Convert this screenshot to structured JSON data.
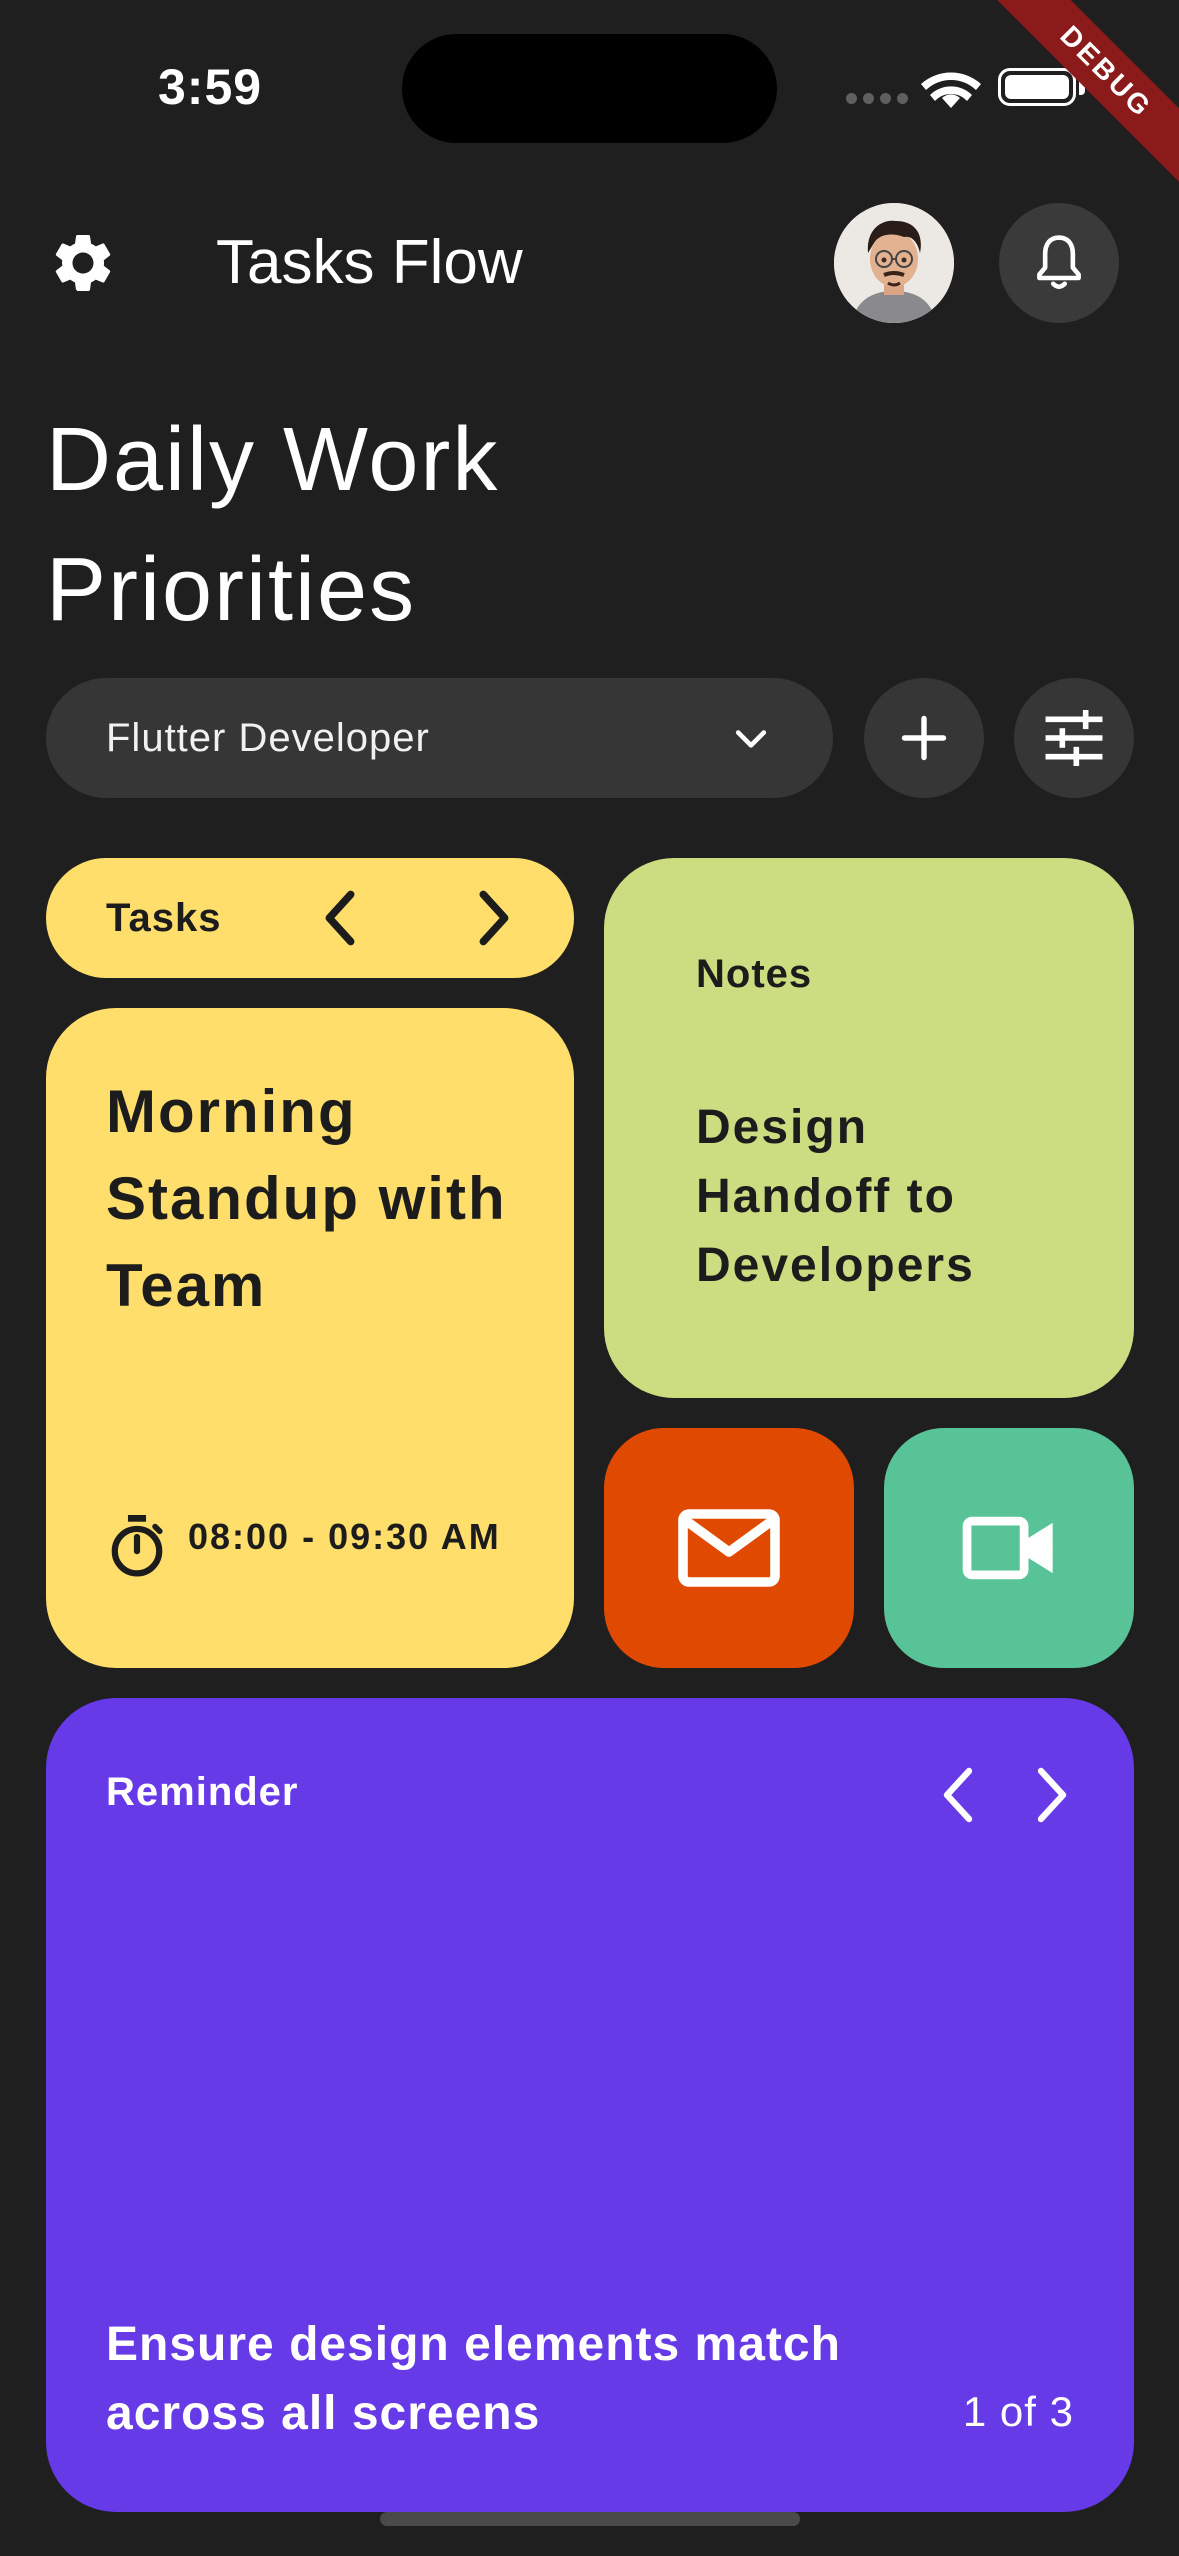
{
  "status_bar": {
    "time": "3:59",
    "debug_banner": "DEBUG"
  },
  "app_bar": {
    "title": "Tasks Flow",
    "settings_icon": "gear-icon",
    "notifications_icon": "bell-icon"
  },
  "heading": "Daily Work Priorities",
  "controls": {
    "role_selected": "Flutter Developer",
    "dropdown_icon": "chevron-down-icon",
    "add_icon": "plus-icon",
    "filter_icon": "sliders-icon"
  },
  "tasks": {
    "label": "Tasks",
    "current": {
      "title": "Morning Standup with Team",
      "time": "08:00 - 09:30 AM"
    }
  },
  "notes": {
    "label": "Notes",
    "title": "Design Handoff to Developers"
  },
  "quick_actions": {
    "mail_icon": "mail-icon",
    "video_icon": "video-camera-icon"
  },
  "reminder": {
    "label": "Reminder",
    "text": "Ensure design elements match across all screens",
    "page": "1 of 3"
  },
  "colors": {
    "background": "#1f1f1f",
    "tasks": "#ffde6b",
    "notes": "#cbdd80",
    "mail": "#e04a00",
    "video": "#58c396",
    "reminder": "#673ae8"
  }
}
